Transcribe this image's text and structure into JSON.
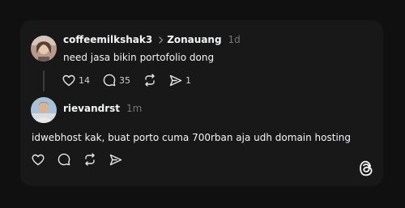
{
  "post": {
    "author": "coffeemilkshak3",
    "reply_to": "Zonauang",
    "time": "1d",
    "text": "need jasa bikin portofolio dong",
    "likes": "14",
    "comments": "35",
    "shares": "1"
  },
  "reply": {
    "author": "rievandrst",
    "time": "1m",
    "text": "idwebhost kak, buat porto cuma 700rban aja udh domain hosting"
  },
  "icons": {
    "like": "heart-icon",
    "comment": "comment-icon",
    "repost": "repost-icon",
    "share": "share-icon",
    "chevron": "chevron-right-icon",
    "brand": "threads-logo-icon"
  },
  "colors": {
    "background": "#101010",
    "card": "#181818",
    "text": "#f3f5f7",
    "muted": "#777777"
  }
}
